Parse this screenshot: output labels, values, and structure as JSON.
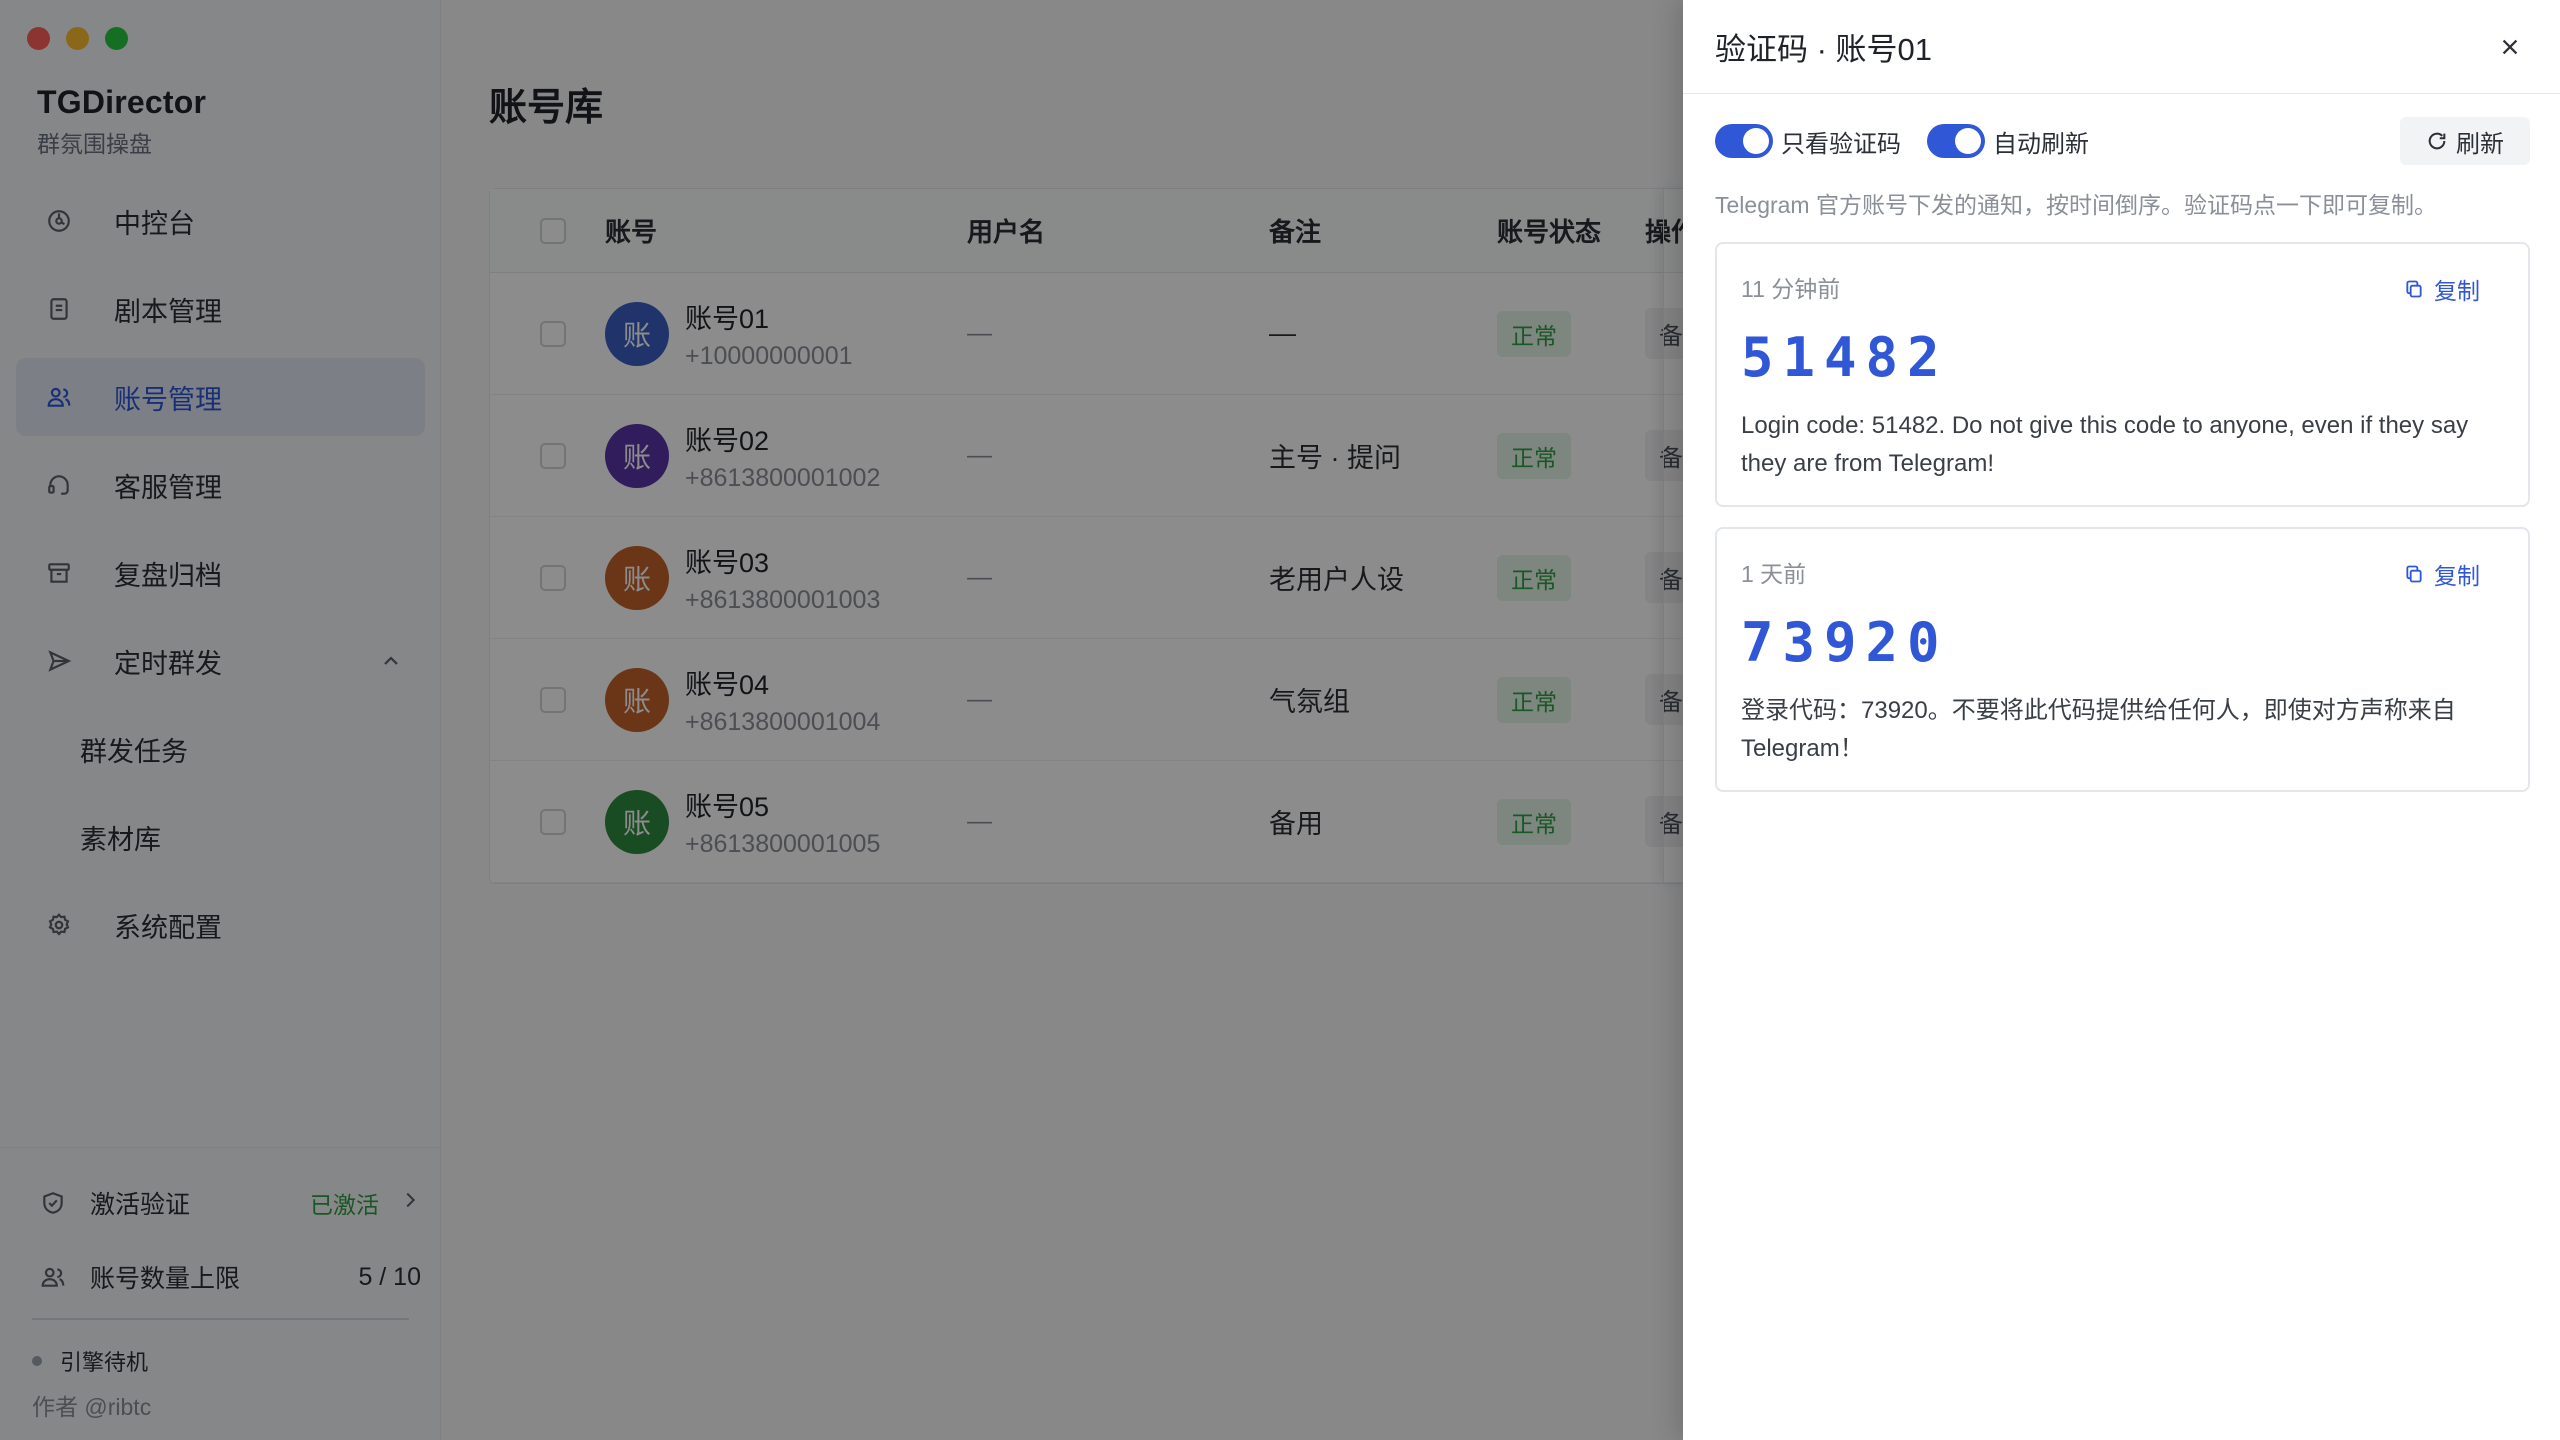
{
  "sidebar": {
    "brand_title": "TGDirector",
    "brand_subtitle": "群氛围操盘",
    "nav": [
      {
        "label": "中控台",
        "icon": "dashboard-icon"
      },
      {
        "label": "剧本管理",
        "icon": "document-icon"
      },
      {
        "label": "账号管理",
        "icon": "users-icon",
        "active": true
      },
      {
        "label": "客服管理",
        "icon": "headset-icon"
      },
      {
        "label": "复盘归档",
        "icon": "archive-icon"
      },
      {
        "label": "定时群发",
        "icon": "send-icon",
        "expanded": true
      },
      {
        "label": "群发任务",
        "sub": true
      },
      {
        "label": "素材库",
        "sub": true
      },
      {
        "label": "系统配置",
        "icon": "gear-icon"
      }
    ],
    "activation_label": "激活验证",
    "activation_status": "已激活",
    "account_limit_label": "账号数量上限",
    "account_limit_value": "5 / 10",
    "engine_status": "引擎待机",
    "author": "作者 @ribtc"
  },
  "main": {
    "title": "账号库",
    "columns": [
      "账号",
      "用户名",
      "备注",
      "账号状态",
      "操作"
    ],
    "rows": [
      {
        "avatar": "账",
        "avatar_color": "#3b5fc4",
        "name": "账号01",
        "phone": "+10000000001",
        "username": "—",
        "note": "—",
        "status": "正常",
        "op": "备"
      },
      {
        "avatar": "账",
        "avatar_color": "#5a35a8",
        "name": "账号02",
        "phone": "+8613800001002",
        "username": "—",
        "note": "主号 · 提问",
        "status": "正常",
        "op": "备"
      },
      {
        "avatar": "账",
        "avatar_color": "#c4622a",
        "name": "账号03",
        "phone": "+8613800001003",
        "username": "—",
        "note": "老用户人设",
        "status": "正常",
        "op": "备"
      },
      {
        "avatar": "账",
        "avatar_color": "#c4622a",
        "name": "账号04",
        "phone": "+8613800001004",
        "username": "—",
        "note": "气氛组",
        "status": "正常",
        "op": "备"
      },
      {
        "avatar": "账",
        "avatar_color": "#2e8b3e",
        "name": "账号05",
        "phone": "+8613800001005",
        "username": "—",
        "note": "备用",
        "status": "正常",
        "op": "备"
      }
    ]
  },
  "drawer": {
    "title": "验证码 · 账号01",
    "toggle_codes_only": "只看验证码",
    "toggle_auto_refresh": "自动刷新",
    "refresh_label": "刷新",
    "hint": "Telegram 官方账号下发的通知，按时间倒序。验证码点一下即可复制。",
    "copy_label": "复制",
    "messages": [
      {
        "time": "11 分钟前",
        "code": "51482",
        "text": "Login code: 51482. Do not give this code to anyone, even if they say they are from Telegram!"
      },
      {
        "time": "1 天前",
        "code": "73920",
        "text": "登录代码：73920。不要将此代码提供给任何人，即使对方声称来自 Telegram！"
      }
    ]
  },
  "colors": {
    "accent": "#2f57d6",
    "success": "#2f9e44",
    "overlay": "rgba(0,0,0,0.45)"
  }
}
